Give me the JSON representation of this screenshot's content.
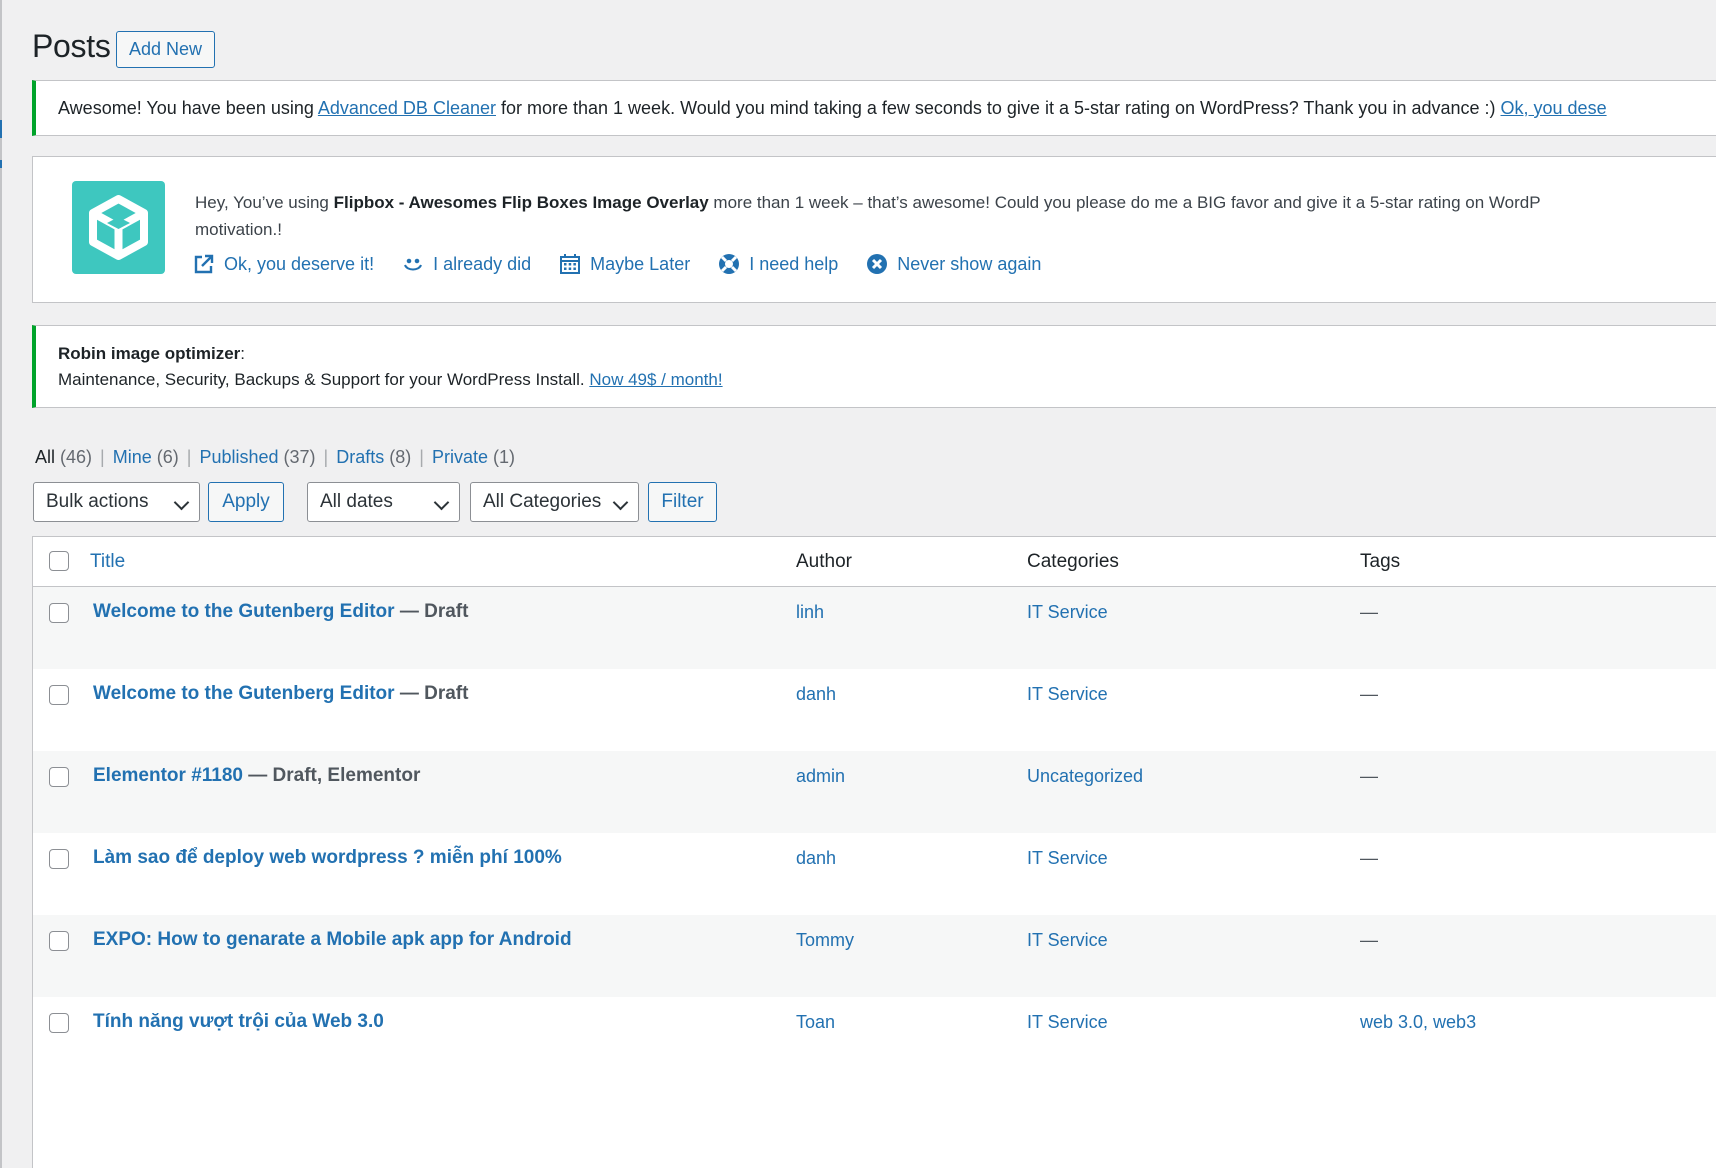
{
  "header": {
    "title": "Posts",
    "add_new": "Add New"
  },
  "notice_db": {
    "before": "Awesome! You have been using ",
    "plugin_link": "Advanced DB Cleaner",
    "after": " for more than 1 week. Would you mind taking a few seconds to give it a 5-star rating on WordPress? Thank you in advance :) ",
    "cta_link": "Ok, you dese"
  },
  "notice_flipbox": {
    "line1_before": "Hey, You’ve using ",
    "line1_bold": "Flipbox - Awesomes Flip Boxes Image Overlay",
    "line1_after": " more than 1 week – that’s awesome! Could you please do me a BIG favor and give it a 5-star rating on WordP",
    "line2": "motivation.!",
    "actions": [
      {
        "label": "Ok, you deserve it!",
        "icon": "external-link-icon"
      },
      {
        "label": "I already did",
        "icon": "smiley-icon"
      },
      {
        "label": "Maybe Later",
        "icon": "calendar-icon"
      },
      {
        "label": "I need help",
        "icon": "lifebuoy-icon"
      },
      {
        "label": "Never show again",
        "icon": "close-circle-icon"
      }
    ],
    "logo_color": "#3ec7bf"
  },
  "notice_robin": {
    "title": "Robin image optimizer",
    "colon": ":",
    "line2_text": "Maintenance, Security, Backups & Support for your WordPress Install. ",
    "line2_link": "Now 49$ / month!"
  },
  "views": [
    {
      "label": "All",
      "count": "(46)",
      "current": true
    },
    {
      "label": "Mine",
      "count": "(6)"
    },
    {
      "label": "Published",
      "count": "(37)"
    },
    {
      "label": "Drafts",
      "count": "(8)"
    },
    {
      "label": "Private",
      "count": "(1)"
    }
  ],
  "filters": {
    "bulk_actions": "Bulk actions",
    "apply": "Apply",
    "dates": "All dates",
    "categories": "All Categories",
    "filter": "Filter"
  },
  "table": {
    "columns": {
      "title": "Title",
      "author": "Author",
      "categories": "Categories",
      "tags": "Tags"
    },
    "rows": [
      {
        "title": "Welcome to the Gutenberg Editor",
        "state": " — Draft",
        "author": "linh",
        "categories": "IT Service",
        "tags": "—"
      },
      {
        "title": "Welcome to the Gutenberg Editor",
        "state": " — Draft",
        "author": "danh",
        "categories": "IT Service",
        "tags": "—"
      },
      {
        "title": "Elementor #1180",
        "state": " — Draft, Elementor",
        "author": "admin",
        "categories": "Uncategorized",
        "tags": "—"
      },
      {
        "title": "Làm sao để deploy web wordpress ? miễn phí 100%",
        "state": "",
        "author": "danh",
        "categories": "IT Service",
        "tags": "—"
      },
      {
        "title": "EXPO: How to genarate a Mobile apk app for Android",
        "state": "",
        "author": "Tommy",
        "categories": "IT Service",
        "tags": "—"
      },
      {
        "title": "Tính năng vượt trội của Web 3.0",
        "state": "",
        "author": "Toan",
        "categories": "IT Service",
        "tags": "web 3.0, web3"
      }
    ]
  },
  "colors": {
    "accent": "#2271b1",
    "success": "#00a32a",
    "background": "#f0f0f1"
  }
}
